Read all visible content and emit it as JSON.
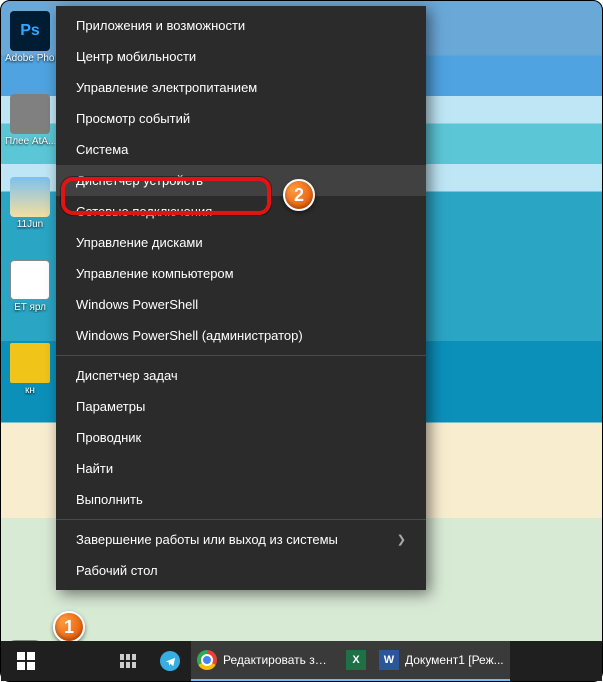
{
  "desktop": {
    "icons": [
      {
        "label": "Adobe Phot..."
      },
      {
        "label": "Плее AtA..."
      },
      {
        "label": "11Jun"
      },
      {
        "label": "ET ярл"
      },
      {
        "label": "кн"
      }
    ]
  },
  "menu": {
    "section1": [
      "Приложения и возможности",
      "Центр мобильности",
      "Управление электропитанием",
      "Просмотр событий",
      "Система",
      "Диспетчер устройств",
      "Сетевые подключения",
      "Управление дисками",
      "Управление компьютером",
      "Windows PowerShell",
      "Windows PowerShell (администратор)"
    ],
    "section2": [
      "Диспетчер задач",
      "Параметры",
      "Проводник",
      "Найти",
      "Выполнить"
    ],
    "section3": [
      "Завершение работы или выход из системы",
      "Рабочий стол"
    ],
    "highlighted_index": 5
  },
  "annotations": {
    "badge1": "1",
    "badge2": "2",
    "highlight_color": "#e11313",
    "badge_color": "#e04e00"
  },
  "taskbar": {
    "apps": [
      {
        "name": "chrome",
        "label": "Редактировать зап..."
      },
      {
        "name": "excel",
        "label": ""
      },
      {
        "name": "word",
        "label": "Документ1 [Реж..."
      }
    ]
  }
}
